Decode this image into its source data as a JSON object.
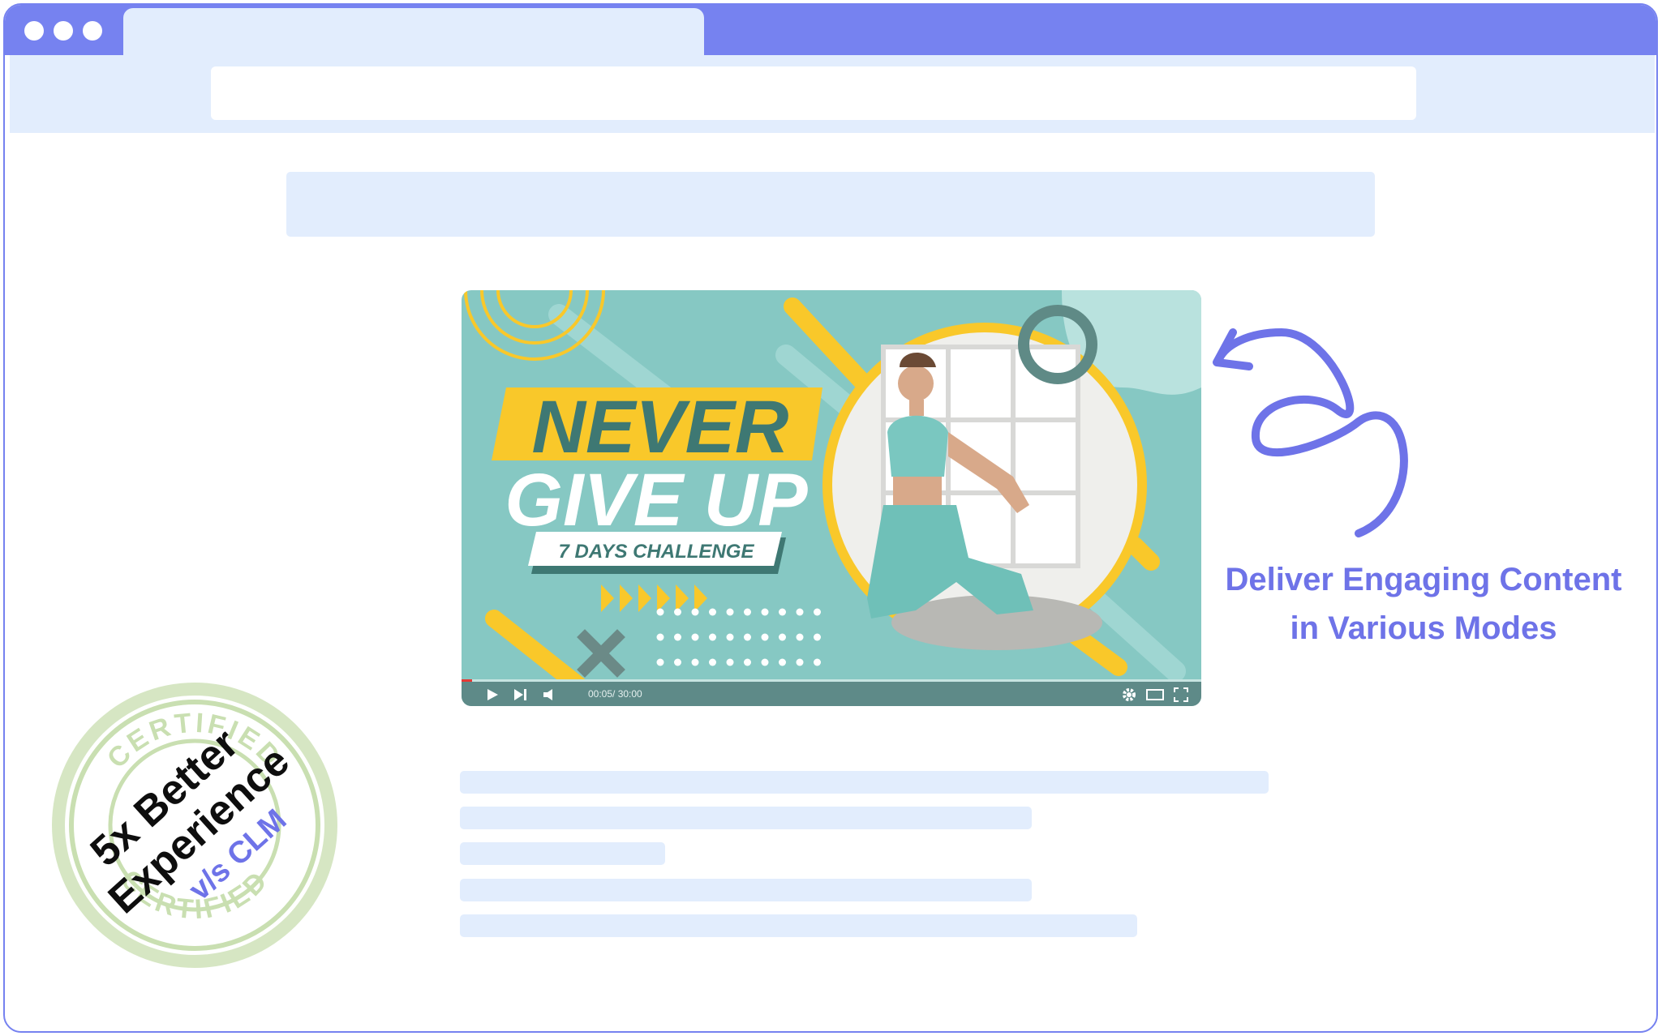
{
  "colors": {
    "accent": "#7682f0",
    "placeholder": "#e2edfd",
    "video_bg": "#86c8c3",
    "video_yellow": "#f9c82a",
    "video_teal_dark": "#3e7873",
    "stamp_green": "#c9dfb1",
    "annotation_text": "#6e73e8"
  },
  "video": {
    "headline_line1": "NEVER",
    "headline_line2": "GIVE UP",
    "subtitle": "7 DAYS CHALLENGE",
    "time": "00:05/ 30:00",
    "progress": 0.014,
    "icons": [
      "play-icon",
      "next-icon",
      "volume-icon",
      "gear-icon",
      "theater-mode-icon",
      "fullscreen-icon"
    ]
  },
  "annotation": {
    "line1": "Deliver Engaging Content",
    "line2": "in Various Modes"
  },
  "stamp": {
    "ring_text": "CERTIFIED",
    "line1": "5x Better",
    "line2": "Experience",
    "line3": "v/s CLM"
  }
}
